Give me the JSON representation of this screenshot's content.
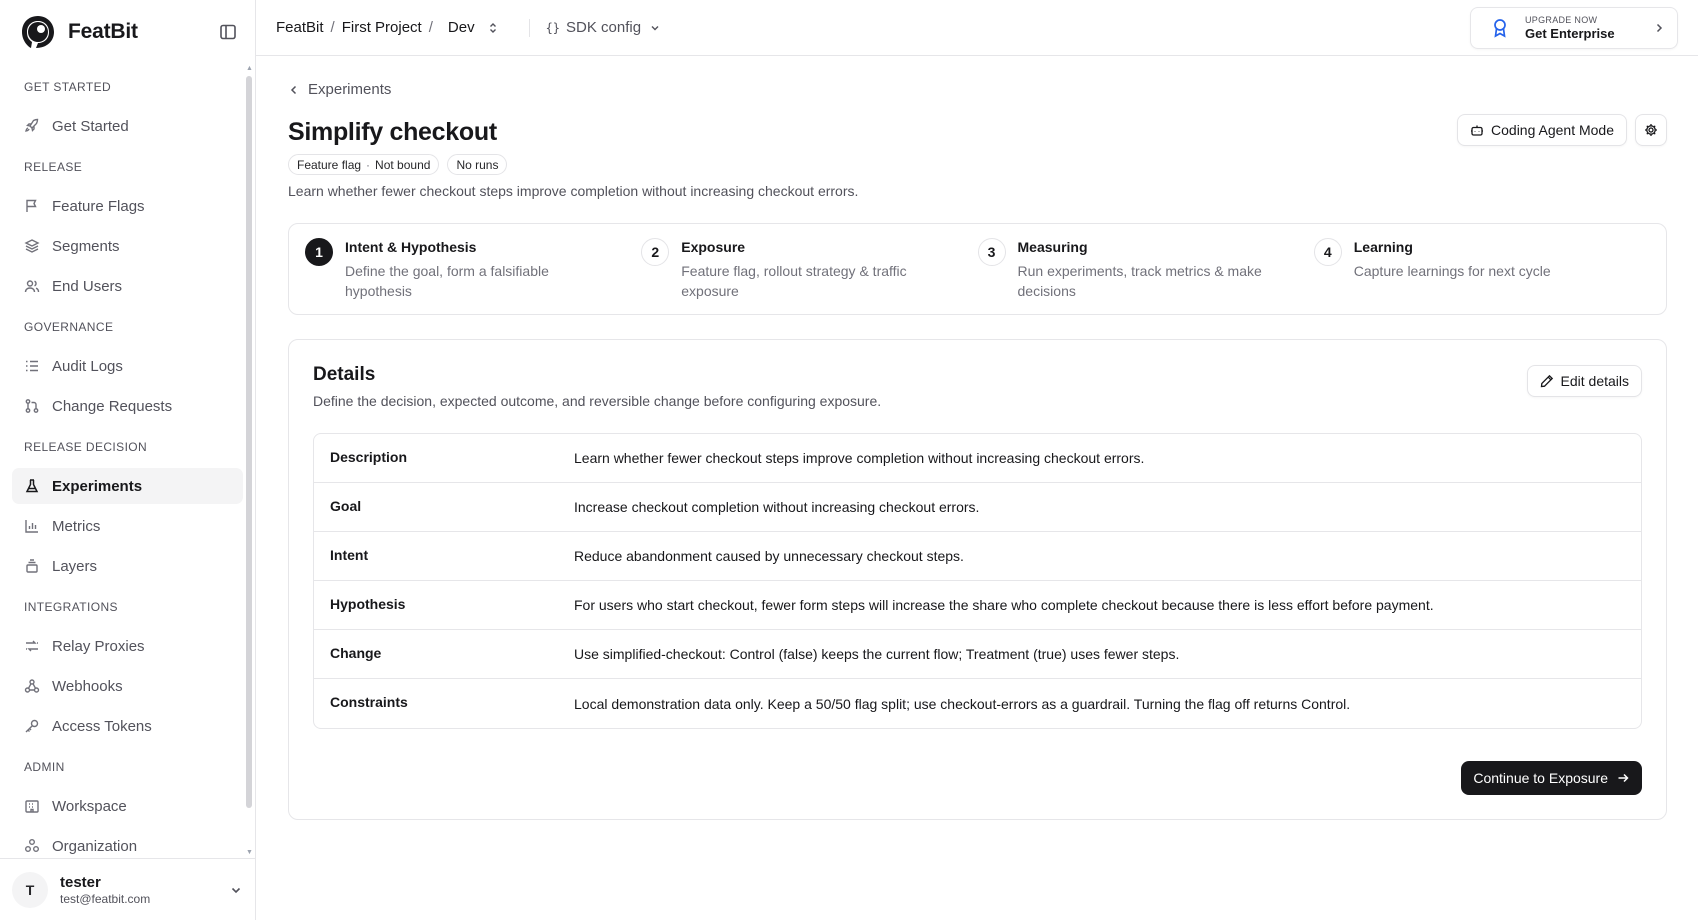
{
  "app": {
    "name": "FeatBit"
  },
  "sidebar": {
    "groups": [
      {
        "label": "GET STARTED",
        "items": [
          {
            "label": "Get Started",
            "icon": "rocket-icon"
          }
        ]
      },
      {
        "label": "RELEASE",
        "items": [
          {
            "label": "Feature Flags",
            "icon": "flag-icon"
          },
          {
            "label": "Segments",
            "icon": "layers-icon"
          },
          {
            "label": "End Users",
            "icon": "users-icon"
          }
        ]
      },
      {
        "label": "GOVERNANCE",
        "items": [
          {
            "label": "Audit Logs",
            "icon": "list-icon"
          },
          {
            "label": "Change Requests",
            "icon": "git-pull-request-icon"
          }
        ]
      },
      {
        "label": "RELEASE DECISION",
        "items": [
          {
            "label": "Experiments",
            "icon": "flask-icon",
            "active": true
          },
          {
            "label": "Metrics",
            "icon": "bar-chart-icon"
          },
          {
            "label": "Layers",
            "icon": "stack-icon"
          }
        ]
      },
      {
        "label": "INTEGRATIONS",
        "items": [
          {
            "label": "Relay Proxies",
            "icon": "relay-icon"
          },
          {
            "label": "Webhooks",
            "icon": "webhook-icon"
          },
          {
            "label": "Access Tokens",
            "icon": "key-icon"
          }
        ]
      },
      {
        "label": "ADMIN",
        "items": [
          {
            "label": "Workspace",
            "icon": "building-icon"
          },
          {
            "label": "Organization",
            "icon": "organization-icon"
          }
        ]
      }
    ],
    "user": {
      "initial": "T",
      "name": "tester",
      "email": "test@featbit.com"
    }
  },
  "topbar": {
    "breadcrumbs": [
      "FeatBit",
      "First Project"
    ],
    "separator": "/",
    "environment": "Dev",
    "sdk_config": "SDK config",
    "upgrade": {
      "small": "UPGRADE NOW",
      "large": "Get Enterprise"
    }
  },
  "page": {
    "back_label": "Experiments",
    "title": "Simplify checkout",
    "badges": {
      "feature_flag": "Feature flag",
      "bound": "Not bound",
      "runs": "No runs"
    },
    "description": "Learn whether fewer checkout steps improve completion without increasing checkout errors.",
    "coding_agent_label": "Coding Agent Mode"
  },
  "steps": [
    {
      "num": "1",
      "title": "Intent & Hypothesis",
      "desc": "Define the goal, form a falsifiable hypothesis",
      "active": true
    },
    {
      "num": "2",
      "title": "Exposure",
      "desc": "Feature flag, rollout strategy & traffic exposure"
    },
    {
      "num": "3",
      "title": "Measuring",
      "desc": "Run experiments, track metrics & make decisions"
    },
    {
      "num": "4",
      "title": "Learning",
      "desc": "Capture learnings for next cycle"
    }
  ],
  "details": {
    "title": "Details",
    "subtitle": "Define the decision, expected outcome, and reversible change before configuring exposure.",
    "edit_label": "Edit details",
    "rows": [
      {
        "key": "Description",
        "value": "Learn whether fewer checkout steps improve completion without increasing checkout errors."
      },
      {
        "key": "Goal",
        "value": "Increase checkout completion without increasing checkout errors."
      },
      {
        "key": "Intent",
        "value": "Reduce abandonment caused by unnecessary checkout steps."
      },
      {
        "key": "Hypothesis",
        "value": "For users who start checkout, fewer form steps will increase the share who complete checkout because there is less effort before payment."
      },
      {
        "key": "Change",
        "value": "Use simplified-checkout: Control (false) keeps the current flow; Treatment (true) uses fewer steps."
      },
      {
        "key": "Constraints",
        "value": "Local demonstration data only. Keep a 50/50 flag split; use checkout-errors as a guardrail. Turning the flag off returns Control."
      }
    ],
    "continue_label": "Continue to Exposure"
  }
}
